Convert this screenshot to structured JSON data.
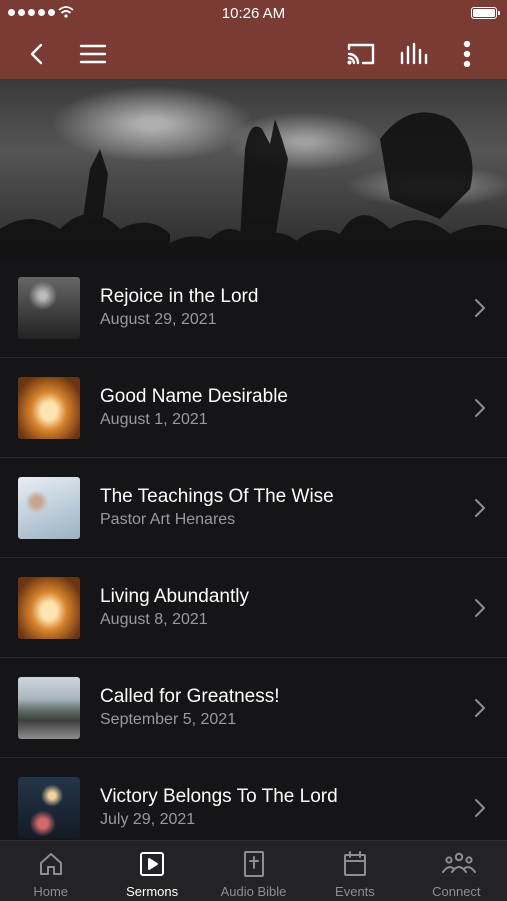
{
  "status_bar": {
    "time": "10:26 AM"
  },
  "header": {
    "icons": [
      "back-arrow-icon",
      "menu-icon",
      "cast-icon",
      "audio-bars-icon",
      "more-vert-icon"
    ]
  },
  "sermons": [
    {
      "title": "Rejoice in the Lord",
      "subtitle": "August 29, 2021"
    },
    {
      "title": "Good Name Desirable",
      "subtitle": "August 1, 2021"
    },
    {
      "title": "The Teachings Of The Wise",
      "subtitle": "Pastor Art Henares"
    },
    {
      "title": "Living Abundantly",
      "subtitle": "August 8, 2021"
    },
    {
      "title": "Called for Greatness!",
      "subtitle": "September 5, 2021"
    },
    {
      "title": "Victory Belongs To The Lord",
      "subtitle": "July 29, 2021"
    }
  ],
  "tabs": [
    {
      "label": "Home",
      "icon": "home-icon"
    },
    {
      "label": "Sermons",
      "icon": "play-square-icon",
      "active": true
    },
    {
      "label": "Audio Bible",
      "icon": "bible-icon"
    },
    {
      "label": "Events",
      "icon": "calendar-icon"
    },
    {
      "label": "Connect",
      "icon": "people-icon"
    }
  ],
  "colors": {
    "header": "#7a3b35",
    "background": "#151517",
    "tabbar": "#232325"
  }
}
